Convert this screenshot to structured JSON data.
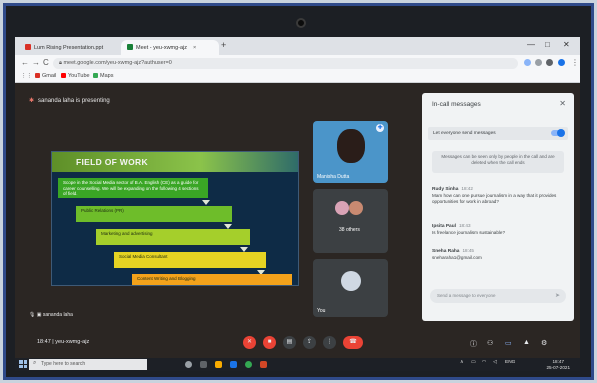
{
  "browser": {
    "tabs": [
      {
        "label": "Lum Rising Presentation.ppt",
        "favicon_color": "#d93025"
      },
      {
        "label": "Meet - yeu-xwmg-ajz",
        "favicon_color": "#188038"
      }
    ],
    "new_tab": "+",
    "window_controls": [
      "—",
      "□",
      "✕"
    ],
    "nav": {
      "back": "←",
      "forward": "→",
      "reload": "C"
    },
    "url": "meet.google.com/yeu-xwmg-ajz?authuser=0",
    "bookmarks": [
      {
        "label": "Gmail",
        "color": "#d93025"
      },
      {
        "label": "YouTube",
        "color": "#ff0000"
      },
      {
        "label": "Maps",
        "color": "#34a853"
      }
    ]
  },
  "meet": {
    "presenting_text": "sananda laha is presenting",
    "slide": {
      "title": "FIELD OF WORK",
      "steps": [
        "Scope in the Social Media sector of B.A. English (CE) as a guide for career counselling. We will be expanding on the following 4 sections of field.",
        "Public Relations (PR)",
        "Marketing and advertising",
        "Social Media Consultant",
        "Content Writing and Blogging"
      ]
    },
    "tiles": {
      "pinned_name": "Manisha Dutta",
      "others_label": "38 others",
      "you_label": "You"
    },
    "self_label": "sananda laha",
    "bottom": {
      "time": "18:47",
      "meeting_code": "yeu-xwmg-ajz"
    }
  },
  "chat": {
    "title": "In-call messages",
    "close": "✕",
    "toggle_label": "Let everyone send messages",
    "notice": "Messages can be seen only by people in the call and are deleted when the call ends",
    "messages": [
      {
        "sender": "Rudy Sinha",
        "time": "18:42",
        "text": "Mam how can one pursue journalism in a way that it provides opportunities for work in abroad?"
      },
      {
        "sender": "Ipsita Paul",
        "time": "18:43",
        "text": "Is freelance journalism sustainable?"
      },
      {
        "sender": "Sneha Raha",
        "time": "18:45",
        "text": "sneharaha1@gmail.com"
      }
    ],
    "input_placeholder": "Send a message to everyone",
    "send_icon": "➤"
  },
  "taskbar": {
    "search_placeholder": "Type here to search",
    "clock_time": "18:47",
    "clock_date": "25-07-2021",
    "lang": "ENG"
  },
  "colors": {
    "meet_bg": "#2b2623",
    "end_call": "#ea4335",
    "chat_bg": "#f1f3f4",
    "bezel": "#2f4a8a"
  }
}
